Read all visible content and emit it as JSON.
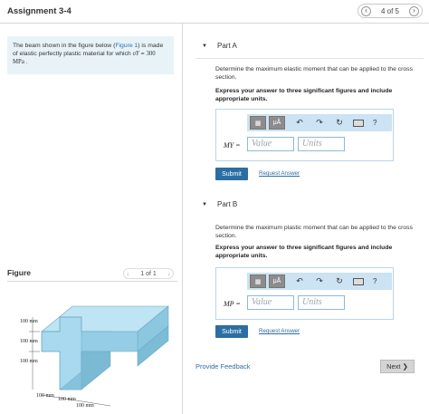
{
  "header": {
    "title": "Assignment 3-4",
    "page_indicator": "4 of 5",
    "prev_icon": "chevron-left-icon",
    "next_icon": "chevron-right-icon"
  },
  "problem": {
    "text_before": "The beam shown in the figure below (",
    "figure_link": "Figure 1",
    "text_after": ") is made of elastic perfectly plastic material for which ",
    "sigma": "σY",
    "eq": " = ",
    "value": "300 MPa",
    "end": " ."
  },
  "figure": {
    "label": "Figure",
    "pager": "1 of 1",
    "dims": {
      "top_flange": "100 mm",
      "web": "100 mm",
      "bottom_flange": "100 mm",
      "b1": "100 mm",
      "b2": "100 mm",
      "b3": "100 mm"
    }
  },
  "partA": {
    "name": "Part A",
    "question": "Determine the maximum elastic moment that can be applied to the cross section.",
    "instruction": "Express your answer to three significant figures and include appropriate units.",
    "symbol": "MY =",
    "value_placeholder": "Value",
    "units_placeholder": "Units",
    "submit": "Submit",
    "request": "Request Answer"
  },
  "partB": {
    "name": "Part B",
    "question": "Determine the maximum plastic moment that can be applied to the cross section.",
    "instruction": "Express your answer to three significant figures and include appropriate units.",
    "symbol": "MP =",
    "value_placeholder": "Value",
    "units_placeholder": "Units",
    "submit": "Submit",
    "request": "Request Answer"
  },
  "toolbar": {
    "mu_label": "μÅ",
    "help": "?"
  },
  "footer": {
    "feedback": "Provide Feedback",
    "next": "Next ❯"
  },
  "colors": {
    "accent": "#2b6ea3",
    "problem_bg": "#e8f3f8",
    "toolbar_bg": "#cbe3f2",
    "beam": "#9fd3ea"
  }
}
